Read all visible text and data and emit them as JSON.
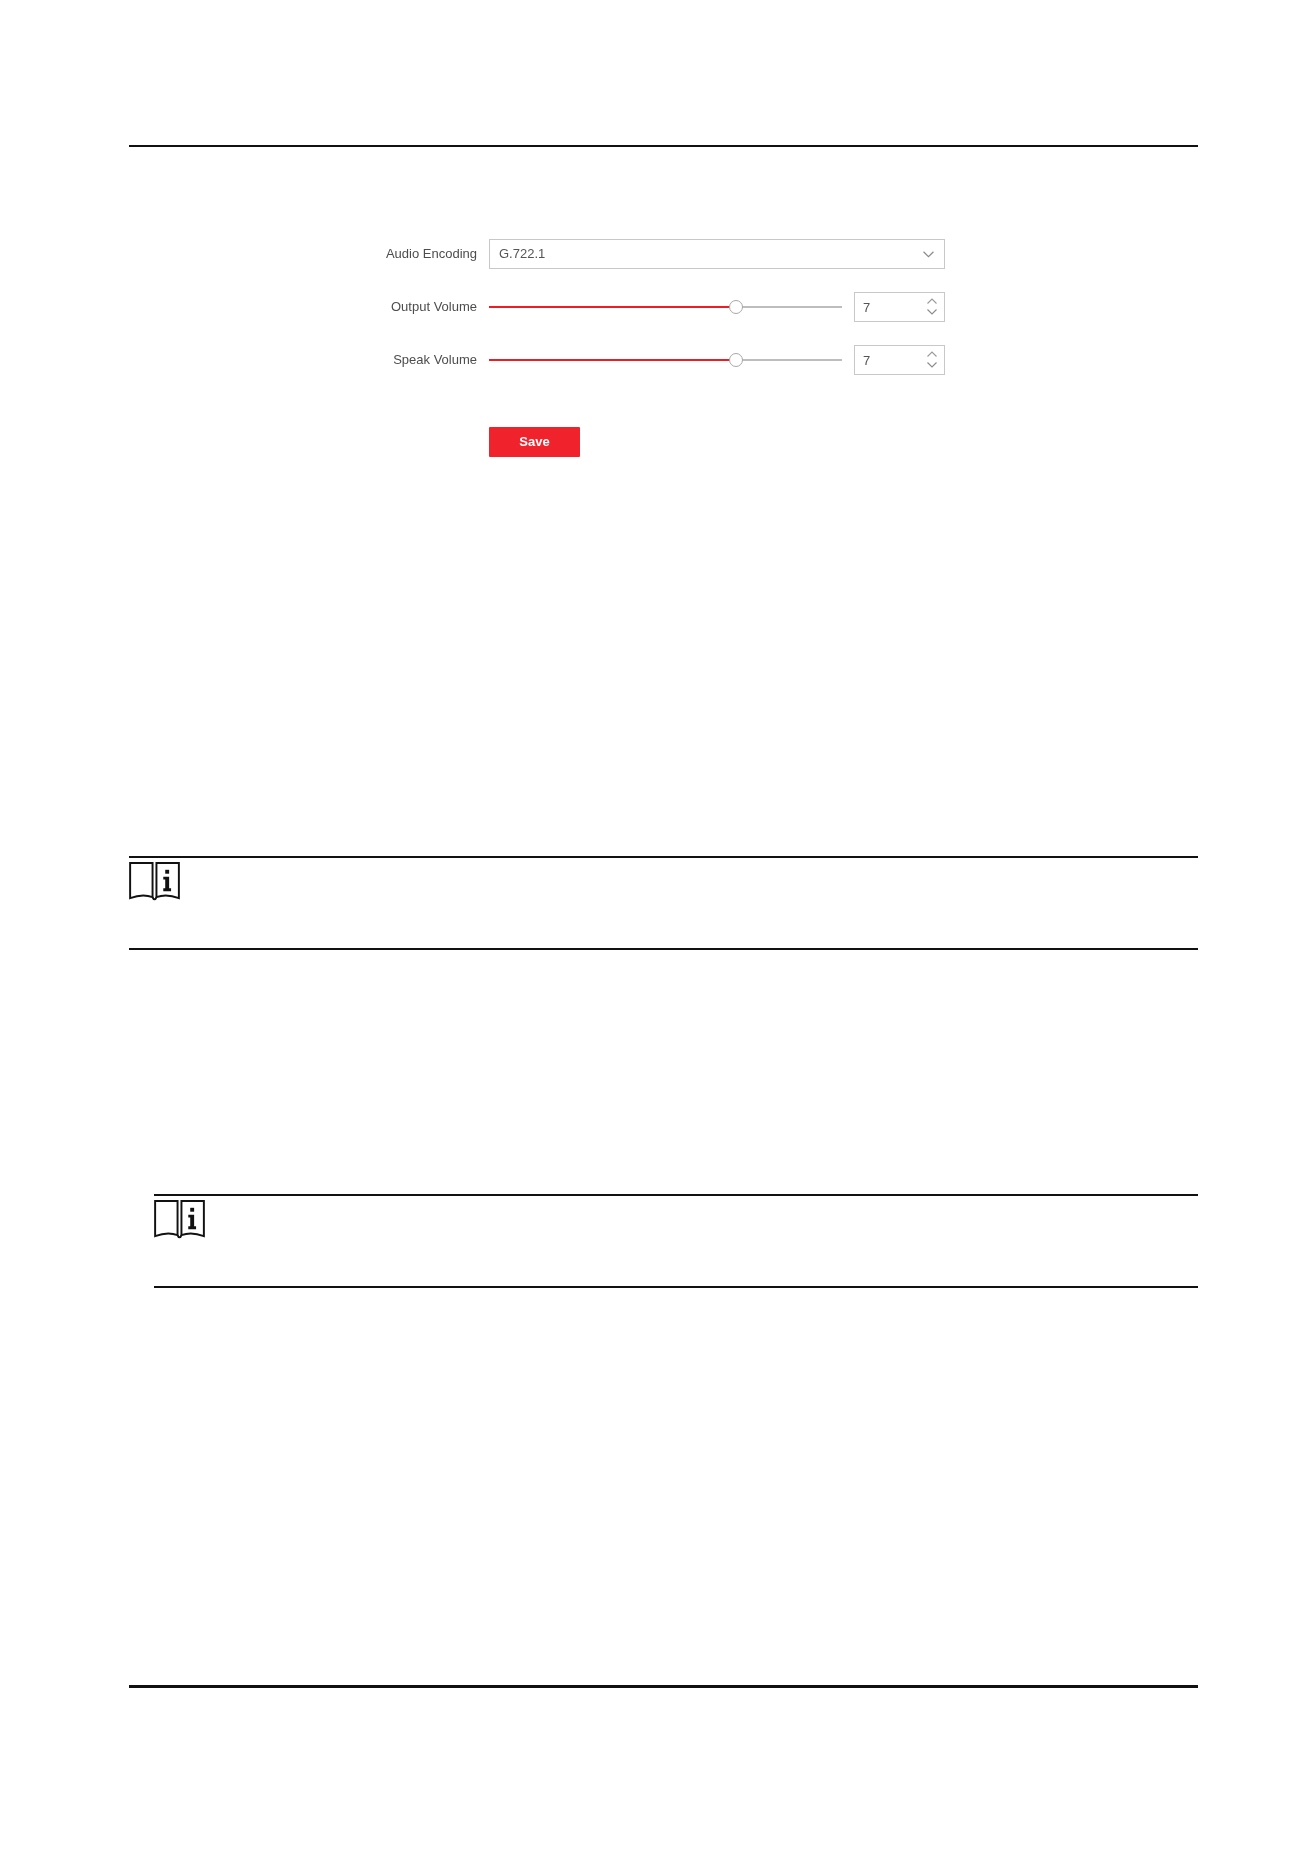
{
  "form": {
    "fields": [
      {
        "kind": "select",
        "label": "Audio Encoding",
        "value": "G.722.1"
      },
      {
        "kind": "slider",
        "label": "Output Volume",
        "level": 0.7,
        "value": "7"
      },
      {
        "kind": "slider",
        "label": "Speak Volume",
        "level": 0.7,
        "value": "7"
      }
    ],
    "save_button": {
      "label": "Save"
    }
  }
}
